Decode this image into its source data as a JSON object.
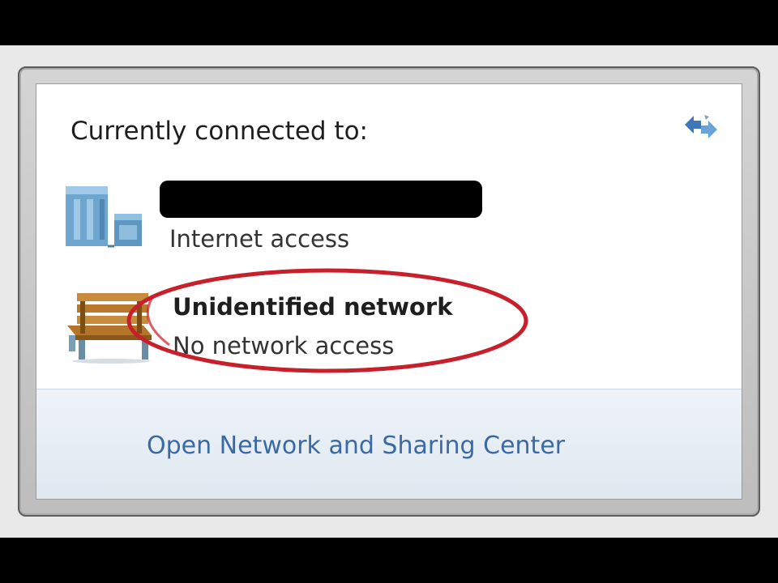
{
  "popup": {
    "heading": "Currently connected to:",
    "refresh_icon": "network-refresh-icon",
    "networks": [
      {
        "name_redacted": true,
        "status": "Internet access",
        "icon": "domain-network-icon"
      },
      {
        "name": "Unidentified network",
        "status": "No network access",
        "icon": "public-network-bench-icon"
      }
    ],
    "footer_link": "Open Network and Sharing Center"
  },
  "colors": {
    "link": "#3a6aa6",
    "annotation": "#c8202a",
    "footer_bg": "#e4ecf4"
  }
}
